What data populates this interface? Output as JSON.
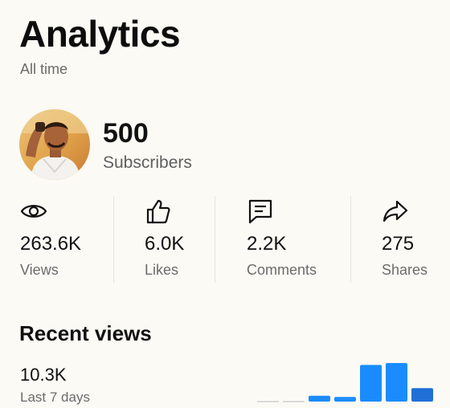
{
  "header": {
    "title": "Analytics",
    "subtitle": "All time"
  },
  "channel": {
    "subscriber_count": "500",
    "subscriber_label": "Subscribers"
  },
  "stats": [
    {
      "icon": "eye-icon",
      "value": "263.6K",
      "label": "Views"
    },
    {
      "icon": "thumbs-up-icon",
      "value": "6.0K",
      "label": "Likes"
    },
    {
      "icon": "comment-icon",
      "value": "2.2K",
      "label": "Comments"
    },
    {
      "icon": "share-icon",
      "value": "275",
      "label": "Shares"
    }
  ],
  "recent": {
    "title": "Recent views",
    "value": "10.3K",
    "period": "Last 7 days"
  },
  "colors": {
    "background": "#fbfaf4",
    "bar_primary": "#1a8cff",
    "bar_secondary": "#1f6fd6",
    "bar_empty": "#d9d9d9"
  },
  "chart_data": {
    "type": "bar",
    "values_fraction_of_max": [
      0.0,
      0.0,
      0.15,
      0.12,
      0.95,
      1.0,
      0.35
    ]
  }
}
